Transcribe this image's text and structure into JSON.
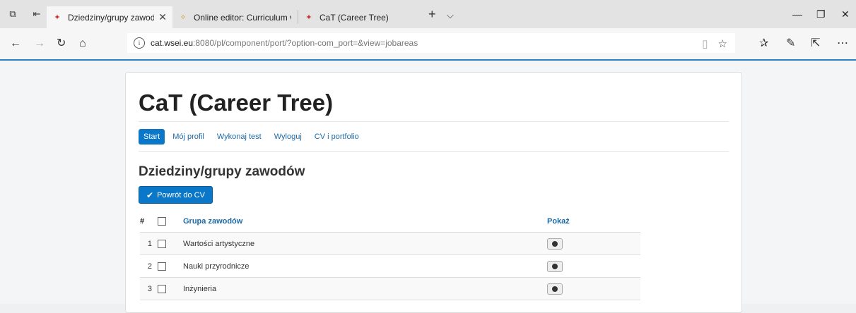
{
  "browser": {
    "tabs": [
      {
        "title": "Dziedziny/grupy zawod",
        "active": true
      },
      {
        "title": "Online editor: Curriculum vi",
        "active": false
      },
      {
        "title": "CaT (Career Tree)",
        "active": false
      }
    ],
    "url_domain": "cat.wsei.eu",
    "url_rest": ":8080/pl/component/port/?option-com_port=&view=jobareas"
  },
  "site": {
    "title": "CaT (Career Tree)",
    "menu": [
      "Start",
      "Mój profil",
      "Wykonaj test",
      "Wyloguj",
      "CV i portfolio"
    ]
  },
  "main": {
    "heading": "Dziedziny/grupy zawodów",
    "back_button": "Powrót do CV",
    "table": {
      "headers": [
        "#",
        "Grupa zawodów",
        "Pokaż"
      ],
      "rows": [
        {
          "num": "1",
          "name": "Wartości artystyczne"
        },
        {
          "num": "2",
          "name": "Nauki przyrodnicze"
        },
        {
          "num": "3",
          "name": "Inżynieria"
        }
      ]
    }
  },
  "colors": {
    "accent": "#0a77c9",
    "link": "#1a6aa8"
  }
}
